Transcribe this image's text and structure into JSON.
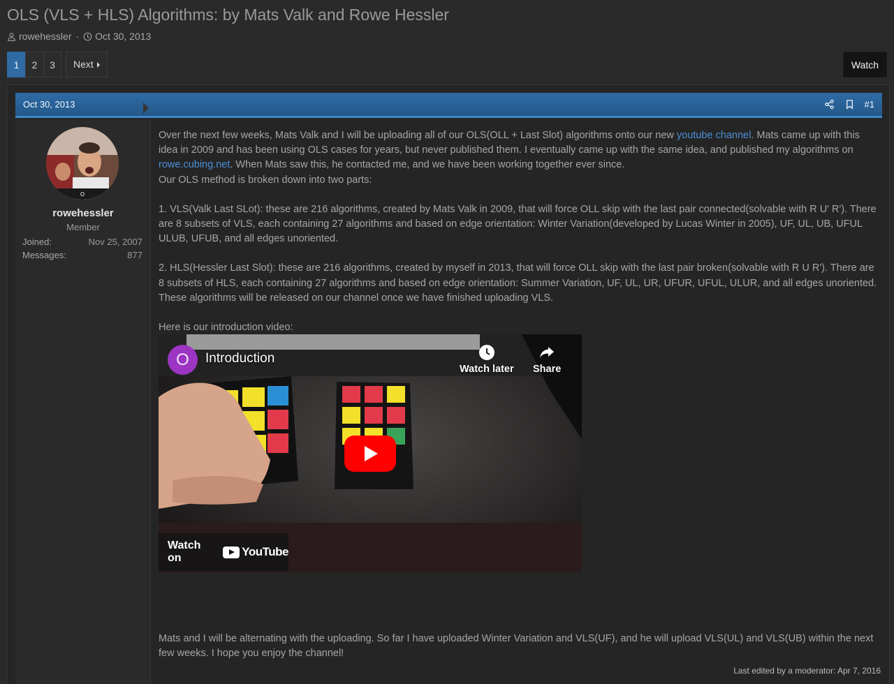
{
  "thread": {
    "title": "OLS (VLS + HLS) Algorithms: by Mats Valk and Rowe Hessler",
    "author": "rowehessler",
    "separator": "·",
    "date": "Oct 30, 2013"
  },
  "pagination": {
    "pages": [
      "1",
      "2",
      "3"
    ],
    "current": "1",
    "next_label": "Next"
  },
  "watch_label": "Watch",
  "post": {
    "date": "Oct 30, 2013",
    "number": "#1",
    "user": {
      "name": "rowehessler",
      "title": "Member",
      "joined_label": "Joined:",
      "joined_value": "Nov 25, 2007",
      "messages_label": "Messages:",
      "messages_value": "877"
    },
    "p1_a": "Over the next few weeks, Mats Valk and I will be uploading all of our OLS(OLL + Last Slot) algorithms onto our new ",
    "p1_link1": "youtube channel",
    "p1_b": ". Mats came up with this idea in 2009 and has been using OLS cases for years, but never published them. I eventually came up with the same idea, and published my algorithms on ",
    "p1_link2": "rowe.cubing.net",
    "p1_c": ". When Mats saw this, he contacted me, and we have been working together ever since.",
    "p2": "Our OLS method is broken down into two parts:",
    "p3": "1. VLS(Valk Last SLot): these are 216 algorithms, created by Mats Valk in 2009, that will force OLL skip with the last pair connected(solvable with R U' R'). There are 8 subsets of VLS, each containing 27 algorithms and based on edge orientation: Winter Variation(developed by Lucas Winter in 2005), UF, UL, UB, UFUL ULUB, UFUB, and all edges unoriented.",
    "p4": "2. HLS(Hessler Last Slot): these are 216 algorithms, created by myself in 2013, that will force OLL skip with the last pair broken(solvable with R U R'). There are 8 subsets of HLS, each containing 27 algorithms and based on edge orientation: Summer Variation, UF, UL, UR, UFUR, UFUL, ULUR, and all edges unoriented. These algorithms will be released on our channel once we have finished uploading VLS.",
    "p5": "Here is our introduction video:",
    "p6": "Mats and I will be alternating with the uploading. So far I have uploaded Winter Variation and VLS(UF), and he will upload VLS(UL) and VLS(UB) within the next few weeks. I hope you enjoy the channel!",
    "edited": "Last edited by a moderator: Apr 7, 2016"
  },
  "video": {
    "channel_initial": "O",
    "title": "Introduction",
    "watch_later": "Watch later",
    "share": "Share",
    "watch_on": "Watch on",
    "youtube": "YouTube"
  },
  "colors": {
    "accent": "#2f6aa3",
    "link": "#4b8fd6",
    "youtube_red": "#ff0000",
    "channel_avatar": "#9c35c3"
  },
  "icons": [
    "user-icon",
    "clock-icon",
    "share-icon",
    "bookmark-icon",
    "watch-later-icon",
    "share-arrow-icon",
    "play-icon",
    "youtube-logo-icon"
  ]
}
